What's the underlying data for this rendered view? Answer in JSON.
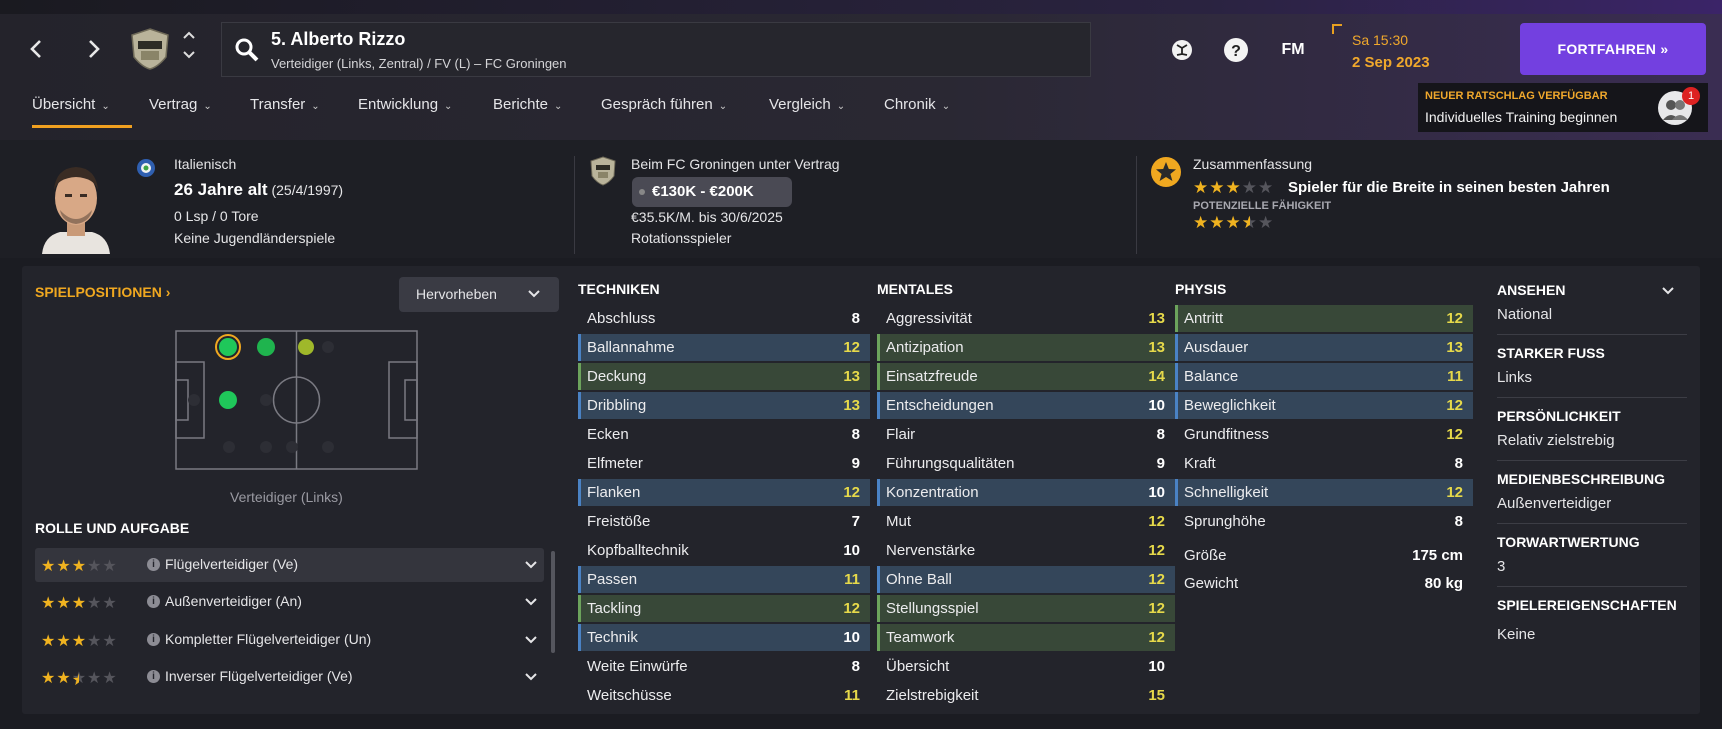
{
  "header": {
    "player_title": "5. Alberto Rizzo",
    "player_subtitle": "Verteidiger (Links, Zentral) / FV (L) – FC Groningen",
    "time": "Sa 15:30",
    "date": "2 Sep 2023",
    "fm_label": "FM",
    "help_label": "?",
    "continue_label": "FORTFAHREN »"
  },
  "tabs": [
    {
      "label": "Übersicht"
    },
    {
      "label": "Vertrag"
    },
    {
      "label": "Transfer"
    },
    {
      "label": "Entwicklung"
    },
    {
      "label": "Berichte"
    },
    {
      "label": "Gespräch führen"
    },
    {
      "label": "Vergleich"
    },
    {
      "label": "Chronik"
    }
  ],
  "advice": {
    "title": "NEUER RATSCHLAG VERFÜGBAR",
    "text": "Individuelles Training beginnen",
    "badge": "1"
  },
  "summary": {
    "nationality": "Italienisch",
    "age": "26 Jahre alt",
    "birthdate": "(25/4/1997)",
    "caps": "0 Lsp / 0 Tore",
    "youth": "Keine Jugendländerspiele",
    "contract_club": "Beim FC Groningen unter Vertrag",
    "value": "€130K - €200K",
    "wage": "€35.5K/M. bis 30/6/2025",
    "squad_status": "Rotationsspieler",
    "summary_label": "Zusammenfassung",
    "summary_text": "Spieler für die Breite in seinen besten Jahren",
    "potential_label": "POTENZIELLE FÄHIGKEIT",
    "current_ability_stars": 3,
    "potential_ability_stars": 3.5
  },
  "positions": {
    "heading": "SPIELPOSITIONEN ›",
    "highlight_button": "Hervorheben",
    "caption": "Verteidiger (Links)"
  },
  "roles": {
    "heading": "ROLLE UND AUFGABE",
    "items": [
      {
        "label": "Flügelverteidiger (Ve)",
        "stars": 3
      },
      {
        "label": "Außenverteidiger (An)",
        "stars": 3
      },
      {
        "label": "Kompletter Flügelverteidiger (Un)",
        "stars": 3
      },
      {
        "label": "Inverser Flügelverteidiger (Ve)",
        "stars": 2.5
      }
    ]
  },
  "techniken": {
    "heading": "TECHNIKEN",
    "rows": [
      {
        "name": "Abschluss",
        "value": "8",
        "hl": "",
        "color": "white"
      },
      {
        "name": "Ballannahme",
        "value": "12",
        "hl": "blue",
        "color": "yellow"
      },
      {
        "name": "Deckung",
        "value": "13",
        "hl": "green",
        "color": "yellow"
      },
      {
        "name": "Dribbling",
        "value": "13",
        "hl": "blue",
        "color": "yellow"
      },
      {
        "name": "Ecken",
        "value": "8",
        "hl": "",
        "color": "white"
      },
      {
        "name": "Elfmeter",
        "value": "9",
        "hl": "",
        "color": "white"
      },
      {
        "name": "Flanken",
        "value": "12",
        "hl": "blue",
        "color": "yellow"
      },
      {
        "name": "Freistöße",
        "value": "7",
        "hl": "",
        "color": "white"
      },
      {
        "name": "Kopfballtechnik",
        "value": "10",
        "hl": "",
        "color": "white"
      },
      {
        "name": "Passen",
        "value": "11",
        "hl": "blue",
        "color": "yellow"
      },
      {
        "name": "Tackling",
        "value": "12",
        "hl": "green",
        "color": "yellow"
      },
      {
        "name": "Technik",
        "value": "10",
        "hl": "blue",
        "color": "white"
      },
      {
        "name": "Weite Einwürfe",
        "value": "8",
        "hl": "",
        "color": "white"
      },
      {
        "name": "Weitschüsse",
        "value": "11",
        "hl": "",
        "color": "yellow"
      }
    ]
  },
  "mentales": {
    "heading": "MENTALES",
    "rows": [
      {
        "name": "Aggressivität",
        "value": "13",
        "hl": "",
        "color": "yellow"
      },
      {
        "name": "Antizipation",
        "value": "13",
        "hl": "green",
        "color": "yellow"
      },
      {
        "name": "Einsatzfreude",
        "value": "14",
        "hl": "green",
        "color": "yellow"
      },
      {
        "name": "Entscheidungen",
        "value": "10",
        "hl": "blue",
        "color": "white"
      },
      {
        "name": "Flair",
        "value": "8",
        "hl": "",
        "color": "white"
      },
      {
        "name": "Führungsqualitäten",
        "value": "9",
        "hl": "",
        "color": "white"
      },
      {
        "name": "Konzentration",
        "value": "10",
        "hl": "blue",
        "color": "white"
      },
      {
        "name": "Mut",
        "value": "12",
        "hl": "",
        "color": "yellow"
      },
      {
        "name": "Nervenstärke",
        "value": "12",
        "hl": "",
        "color": "yellow"
      },
      {
        "name": "Ohne Ball",
        "value": "12",
        "hl": "blue",
        "color": "yellow"
      },
      {
        "name": "Stellungsspiel",
        "value": "12",
        "hl": "green",
        "color": "yellow"
      },
      {
        "name": "Teamwork",
        "value": "12",
        "hl": "green",
        "color": "yellow"
      },
      {
        "name": "Übersicht",
        "value": "10",
        "hl": "",
        "color": "white"
      },
      {
        "name": "Zielstrebigkeit",
        "value": "15",
        "hl": "",
        "color": "yellow"
      }
    ]
  },
  "physis": {
    "heading": "PHYSIS",
    "rows": [
      {
        "name": "Antritt",
        "value": "12",
        "hl": "green",
        "color": "yellow"
      },
      {
        "name": "Ausdauer",
        "value": "13",
        "hl": "blue",
        "color": "yellow"
      },
      {
        "name": "Balance",
        "value": "11",
        "hl": "blue",
        "color": "yellow"
      },
      {
        "name": "Beweglichkeit",
        "value": "12",
        "hl": "blue",
        "color": "yellow"
      },
      {
        "name": "Grundfitness",
        "value": "12",
        "hl": "",
        "color": "yellow"
      },
      {
        "name": "Kraft",
        "value": "8",
        "hl": "",
        "color": "white"
      },
      {
        "name": "Schnelligkeit",
        "value": "12",
        "hl": "blue",
        "color": "yellow"
      },
      {
        "name": "Sprunghöhe",
        "value": "8",
        "hl": "",
        "color": "white"
      }
    ],
    "extra": [
      {
        "name": "Größe",
        "value": "175 cm"
      },
      {
        "name": "Gewicht",
        "value": "80 kg"
      }
    ]
  },
  "info": {
    "items": [
      {
        "label": "ANSEHEN",
        "value": "National"
      },
      {
        "label": "STARKER FUSS",
        "value": "Links"
      },
      {
        "label": "PERSÖNLICHKEIT",
        "value": "Relativ zielstrebig"
      },
      {
        "label": "MEDIENBESCHREIBUNG",
        "value": "Außenverteidiger"
      },
      {
        "label": "TORWARTWERTUNG",
        "value": "3"
      },
      {
        "label": "SPIELEREIGENSCHAFTEN",
        "value": "Keine"
      }
    ]
  },
  "colors": {
    "accent_orange": "#f0a820",
    "button_purple": "#7340e0",
    "attr_yellow": "#e6d94a",
    "row_blue": "#34465a",
    "row_green": "#384838"
  }
}
